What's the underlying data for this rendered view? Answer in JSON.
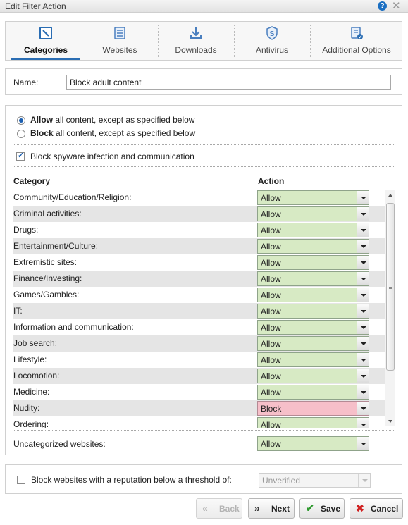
{
  "window": {
    "title": "Edit Filter Action"
  },
  "tabs": [
    {
      "label": "Categories",
      "icon": "categories-icon"
    },
    {
      "label": "Websites",
      "icon": "websites-icon"
    },
    {
      "label": "Downloads",
      "icon": "downloads-icon"
    },
    {
      "label": "Antivirus",
      "icon": "antivirus-icon"
    },
    {
      "label": "Additional Options",
      "icon": "additional-options-icon"
    }
  ],
  "name": {
    "label": "Name:",
    "value": "Block adult content"
  },
  "mode": {
    "allow_bold": "Allow",
    "allow_rest": "all content, except as specified below",
    "block_bold": "Block",
    "block_rest": "all content, except as specified below",
    "selected": "allow"
  },
  "spyware": {
    "label": "Block spyware infection and communication",
    "checked": true
  },
  "table": {
    "header_category": "Category",
    "header_action": "Action",
    "rows": [
      {
        "category": "Community/Education/Religion:",
        "action": "Allow"
      },
      {
        "category": "Criminal activities:",
        "action": "Allow"
      },
      {
        "category": "Drugs:",
        "action": "Allow"
      },
      {
        "category": "Entertainment/Culture:",
        "action": "Allow"
      },
      {
        "category": "Extremistic sites:",
        "action": "Allow"
      },
      {
        "category": "Finance/Investing:",
        "action": "Allow"
      },
      {
        "category": "Games/Gambles:",
        "action": "Allow"
      },
      {
        "category": "IT:",
        "action": "Allow"
      },
      {
        "category": "Information and communication:",
        "action": "Allow"
      },
      {
        "category": "Job search:",
        "action": "Allow"
      },
      {
        "category": "Lifestyle:",
        "action": "Allow"
      },
      {
        "category": "Locomotion:",
        "action": "Allow"
      },
      {
        "category": "Medicine:",
        "action": "Allow"
      },
      {
        "category": "Nudity:",
        "action": "Block"
      },
      {
        "category": "Ordering:",
        "action": "Allow"
      }
    ]
  },
  "uncategorized": {
    "label": "Uncategorized websites:",
    "action": "Allow"
  },
  "reputation": {
    "label": "Block websites with a reputation below a threshold of:",
    "value": "Unverified",
    "checked": false
  },
  "buttons": {
    "back": "Back",
    "next": "Next",
    "save": "Save",
    "cancel": "Cancel"
  },
  "colors": {
    "allow_bg": "#d7eac4",
    "block_bg": "#f6bfc9",
    "accent": "#2a6db3"
  }
}
